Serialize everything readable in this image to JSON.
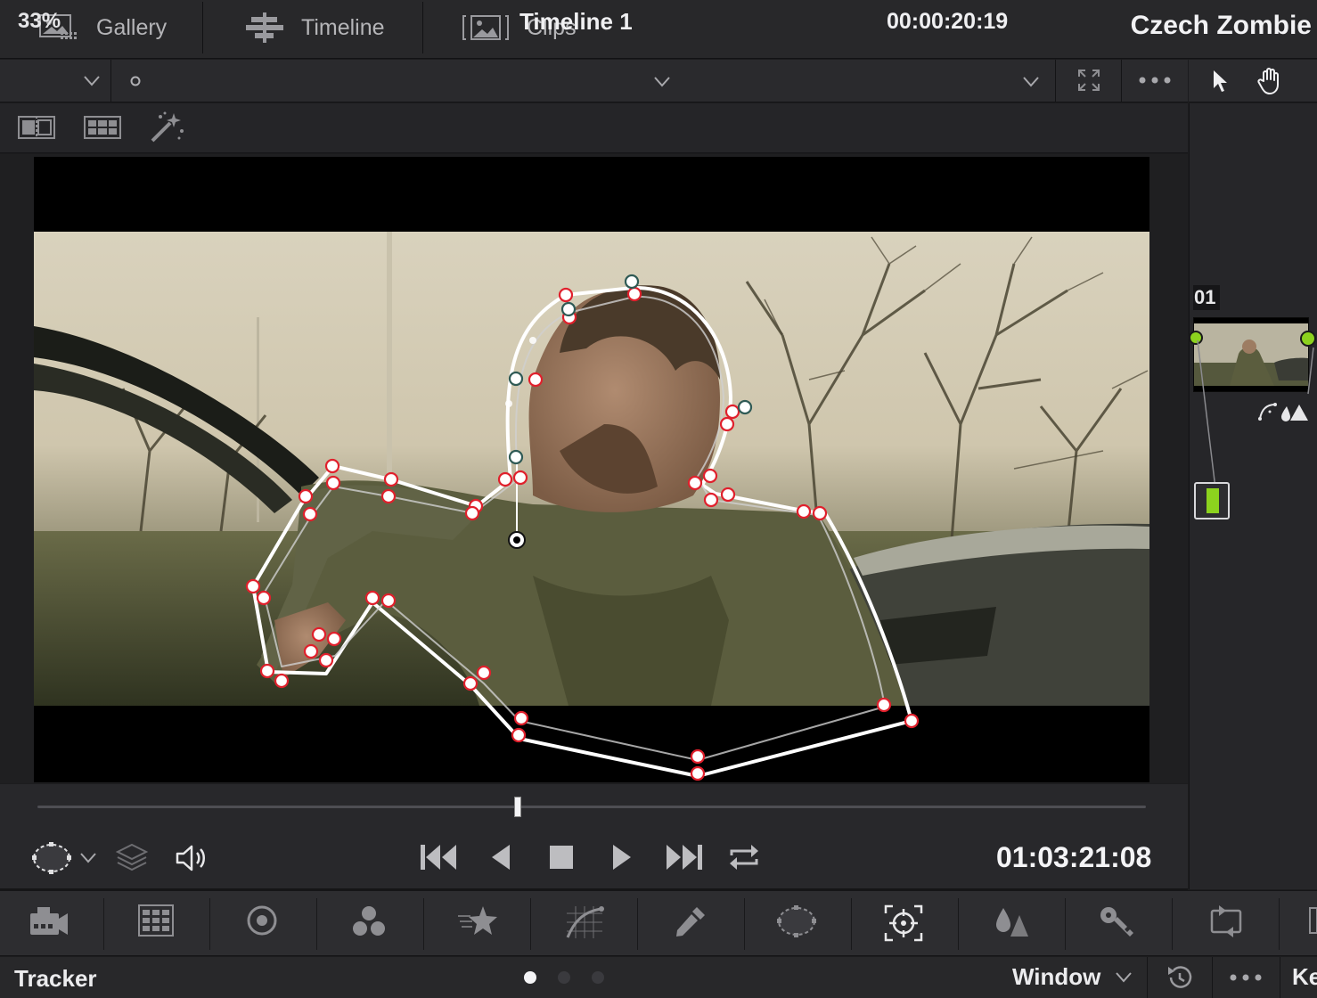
{
  "top_nav": {
    "tabs": [
      {
        "label": "Gallery",
        "icon": "gallery-icon"
      },
      {
        "label": "Timeline",
        "icon": "timeline-icon"
      },
      {
        "label": "Clips",
        "icon": "clips-icon"
      }
    ],
    "project_title": "Czech Zombie"
  },
  "viewer": {
    "zoom": "33%",
    "timeline_name": "Timeline 1",
    "source_timecode": "00:00:20:19",
    "playhead_position": 0.433,
    "record_timecode": "01:03:21:08"
  },
  "node_editor": {
    "node_number": "01"
  },
  "palette": {
    "items": [
      "camera-raw-icon",
      "color-match-icon",
      "color-wheels-icon",
      "rgb-mixer-icon",
      "motion-effects-icon",
      "curves-icon",
      "qualifier-icon",
      "window-icon",
      "tracker-icon",
      "blur-icon",
      "key-icon",
      "sizing-icon"
    ],
    "active": "tracker-icon"
  },
  "bottom_panel": {
    "panel_name": "Tracker",
    "mode_label": "Window",
    "next_panel_label": "Ke",
    "pages": 3,
    "active_page": 0
  },
  "colors": {
    "background": "#1c1c1e",
    "panel": "#28282a",
    "accent_red": "#e0202c",
    "node_green": "#8cd21e",
    "text": "#f0f0f2"
  }
}
